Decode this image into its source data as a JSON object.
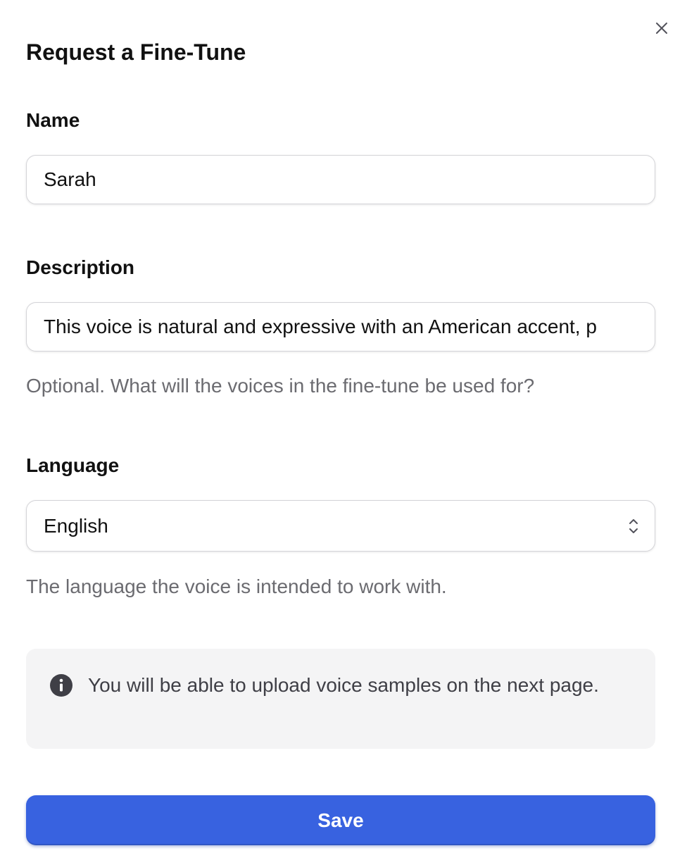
{
  "dialog": {
    "title": "Request a Fine-Tune",
    "close_icon": "close-icon"
  },
  "form": {
    "name": {
      "label": "Name",
      "value": "Sarah"
    },
    "description": {
      "label": "Description",
      "value": "This voice is natural and expressive with an American accent, p",
      "helper": "Optional. What will the voices in the fine-tune be used for?"
    },
    "language": {
      "label": "Language",
      "selected": "English",
      "helper": "The language the voice is intended to work with.",
      "chevron_icon": "chevron-up-down-icon"
    }
  },
  "notice": {
    "icon": "info-icon",
    "text": "You will be able to upload voice samples on the next page."
  },
  "actions": {
    "save_label": "Save"
  },
  "colors": {
    "primary": "#3862e0",
    "notice_background": "#f4f4f5",
    "helper_text": "#6b6b70"
  }
}
